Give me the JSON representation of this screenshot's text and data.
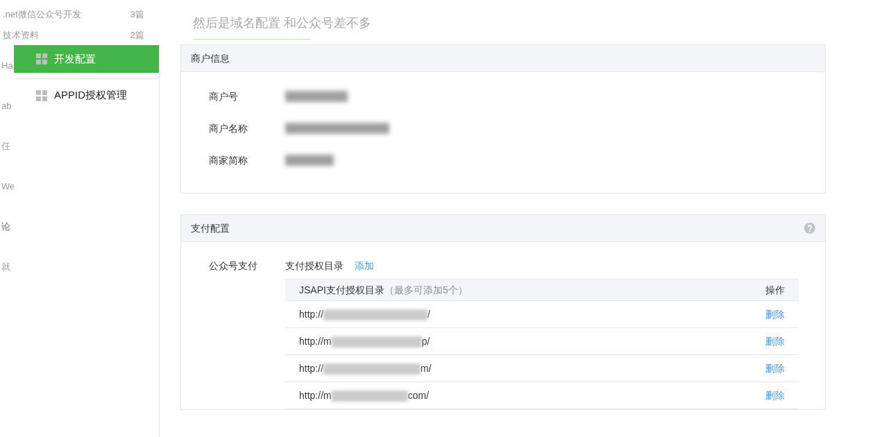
{
  "background_page": {
    "articles": [
      {
        "title": ".net微信公众号开发",
        "count": "3篇"
      },
      {
        "title": "技术资料",
        "count": "2篇"
      }
    ],
    "fragments": [
      "Ha",
      "ab",
      "任",
      "We"
    ],
    "comments_heading": "论",
    "comment_fragments": [
      "就"
    ],
    "heading": "然后是域名配置 和公众号差不多"
  },
  "sidebar": {
    "items": [
      {
        "label": "开发配置",
        "selected": true
      },
      {
        "label": "APPID授权管理",
        "selected": false
      }
    ]
  },
  "merchant_card": {
    "title": "商户信息",
    "fields": [
      {
        "label": "商户号"
      },
      {
        "label": "商户名称"
      },
      {
        "label": "商家简称"
      }
    ]
  },
  "payment_card": {
    "title": "支付配置",
    "section_label": "公众号支付",
    "directory_label": "支付授权目录",
    "add_link": "添加",
    "table": {
      "column_title": "JSAPI支付授权目录",
      "column_hint": "（最多可添加5个）",
      "action_column": "操作",
      "rows": [
        {
          "prefix": "http://",
          "suffix": "/",
          "action": "删除"
        },
        {
          "prefix": "http://m",
          "suffix": "p/",
          "action": "删除"
        },
        {
          "prefix": "http://",
          "suffix": "m/",
          "action": "删除"
        },
        {
          "prefix": "http://m",
          "suffix": "com/",
          "action": "删除"
        }
      ]
    }
  }
}
